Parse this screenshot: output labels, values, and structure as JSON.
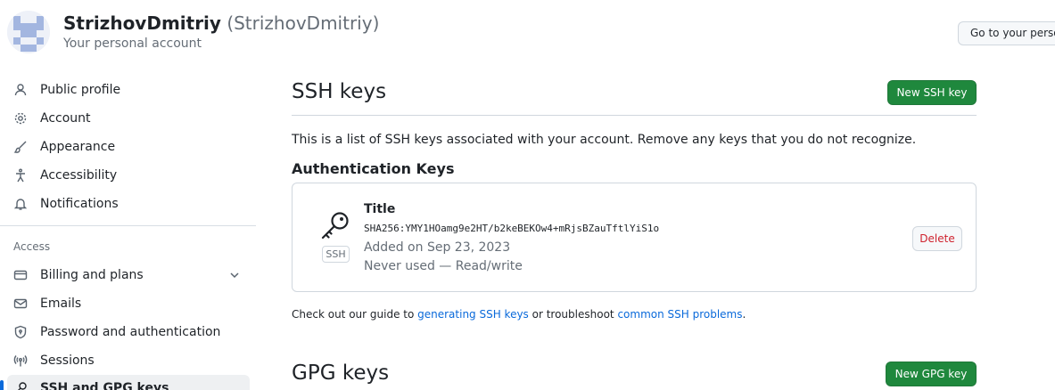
{
  "header": {
    "name": "StrizhovDmitriy",
    "login": "(StrizhovDmitriy)",
    "subtitle": "Your personal account",
    "goto_button": "Go to your personal profile"
  },
  "sidebar": {
    "items": [
      {
        "label": "Public profile",
        "icon": "person-icon"
      },
      {
        "label": "Account",
        "icon": "gear-icon"
      },
      {
        "label": "Appearance",
        "icon": "paintbrush-icon"
      },
      {
        "label": "Accessibility",
        "icon": "accessibility-icon"
      },
      {
        "label": "Notifications",
        "icon": "bell-icon"
      }
    ],
    "section_label": "Access",
    "access_items": [
      {
        "label": "Billing and plans",
        "icon": "credit-card-icon"
      },
      {
        "label": "Emails",
        "icon": "mail-icon"
      },
      {
        "label": "Password and authentication",
        "icon": "shield-lock-icon"
      },
      {
        "label": "Sessions",
        "icon": "broadcast-icon"
      },
      {
        "label": "SSH and GPG keys",
        "icon": "key-icon"
      }
    ]
  },
  "ssh": {
    "title": "SSH keys",
    "new_button": "New SSH key",
    "intro": "This is a list of SSH keys associated with your account. Remove any keys that you do not recognize.",
    "auth_heading": "Authentication Keys",
    "key": {
      "title": "Title",
      "fingerprint": "SHA256:YMY1HOamg9e2HT/b2keBEKOw4+mRjsBZauTftlYiS1o",
      "added": "Added on Sep 23, 2023",
      "usage": "Never used — Read/write",
      "badge": "SSH",
      "delete_label": "Delete"
    },
    "guide": {
      "prefix": "Check out our guide to ",
      "link1": "generating SSH keys",
      "middle": " or troubleshoot ",
      "link2": "common SSH problems",
      "suffix": "."
    }
  },
  "gpg": {
    "title": "GPG keys",
    "new_button": "New GPG key"
  },
  "colors": {
    "primary_button": "#1f883d",
    "link": "#0969da",
    "danger": "#cf222e",
    "active_indicator": "#0969da"
  }
}
